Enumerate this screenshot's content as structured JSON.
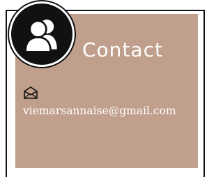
{
  "contact": {
    "title": "Contact",
    "email": "viemarsannaise@gmail.com",
    "icons": {
      "avatar": "users-icon",
      "mail": "envelope-icon"
    }
  },
  "colors": {
    "card_background": "#c09f8c",
    "text": "#ffffff",
    "border": "#111111",
    "avatar_background": "#111111"
  }
}
